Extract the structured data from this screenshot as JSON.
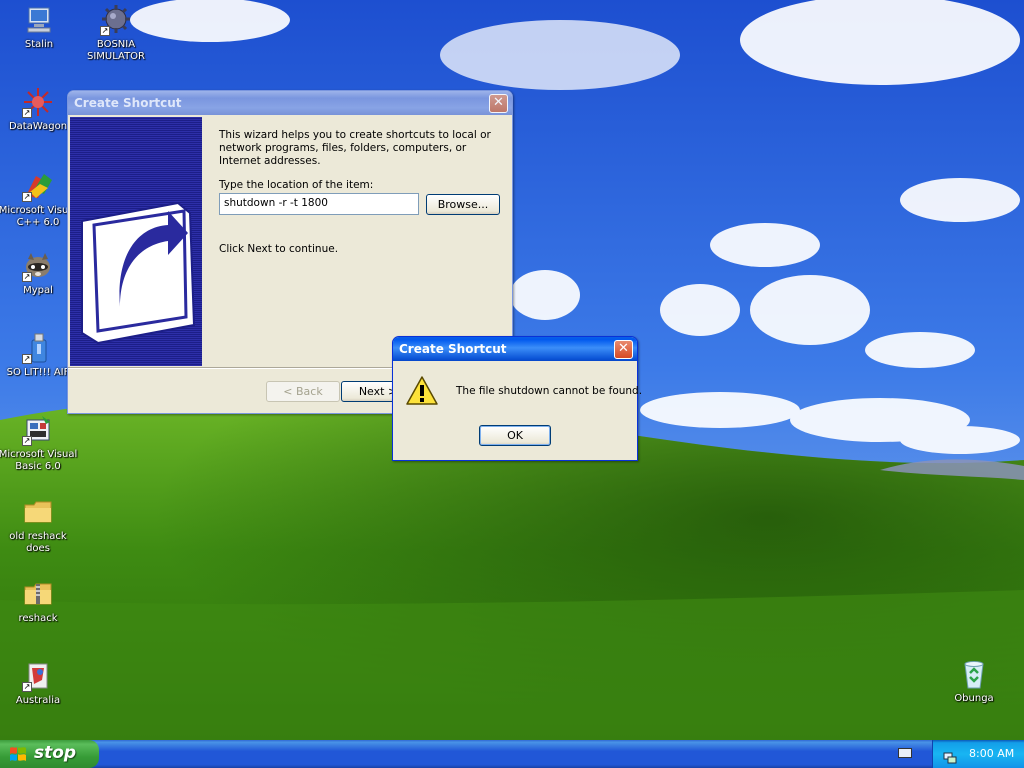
{
  "desktop": {
    "icons": [
      {
        "label": "Stalin",
        "icon": "network-computer-icon"
      },
      {
        "label": "BOSNIA SIMULATOR",
        "icon": "gear-ball-icon"
      },
      {
        "label": "DataWagon",
        "icon": "red-burst-icon"
      },
      {
        "label": "Microsoft Visual C++ 6.0",
        "icon": "visual-cpp-icon"
      },
      {
        "label": "Mypal",
        "icon": "raccoon-icon"
      },
      {
        "label": "SO LIT!!! AIF",
        "icon": "usb-drive-icon"
      },
      {
        "label": "Microsoft Visual Basic 6.0",
        "icon": "visual-basic-icon"
      },
      {
        "label": "old reshack does",
        "icon": "folder-icon"
      },
      {
        "label": "reshack",
        "icon": "zip-folder-icon"
      },
      {
        "label": "Australia",
        "icon": "australia-app-icon"
      },
      {
        "label": "Obunga",
        "icon": "recycle-bin-icon"
      }
    ]
  },
  "wizard": {
    "title": "Create Shortcut",
    "intro": "This wizard helps you to create shortcuts to local or network programs, files, folders, computers, or Internet addresses.",
    "location_label": "Type the location of the item:",
    "location_value": "shutdown -r -t 1800",
    "browse_label": "Browse...",
    "continue_text": "Click Next to continue.",
    "back_label": "< Back",
    "next_label": "Next >"
  },
  "alert": {
    "title": "Create Shortcut",
    "message": "The file shutdown cannot be found.",
    "ok_label": "OK",
    "icon": "warning-icon"
  },
  "taskbar": {
    "start_label": "stop",
    "clock": "8:00 AM"
  },
  "colors": {
    "titlebar_active": "#0058ee",
    "taskbar": "#2157d7",
    "start_green": "#379c37",
    "tray": "#18b5f2"
  }
}
